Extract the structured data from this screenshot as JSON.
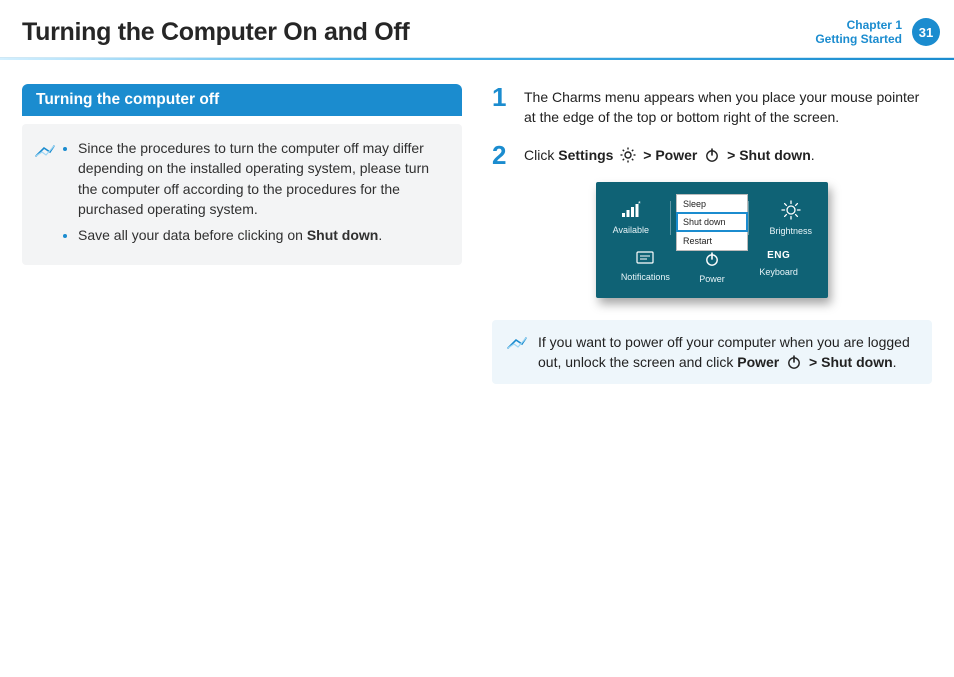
{
  "header": {
    "title": "Turning the Computer On and Off",
    "chapter_line1": "Chapter 1",
    "chapter_line2": "Getting Started",
    "page_number": "31"
  },
  "section": {
    "title": "Turning the computer off"
  },
  "note": {
    "bullets": [
      {
        "text_a": "Since the procedures to turn the computer off may differ depending on the installed operating system, please turn the computer off according to the procedures for the purchased operating system."
      },
      {
        "text_a": "Save all your data before clicking on ",
        "bold_b": "Shut down",
        "text_c": "."
      }
    ]
  },
  "steps": [
    {
      "num": "1",
      "text": "The Charms menu appears when you place your mouse pointer at the edge of the top or bottom right of the screen."
    },
    {
      "num": "2",
      "p1_a": "Click ",
      "p1_bold1": "Settings",
      "p1_sep1": " > ",
      "p1_bold2": "Power",
      "p1_sep2": " > ",
      "p1_bold3": "Shut down",
      "p1_end": "."
    }
  ],
  "charms": {
    "menu": {
      "sleep": "Sleep",
      "shutdown": "Shut down",
      "restart": "Restart"
    },
    "top_left": "Available",
    "top_right": "Brightness",
    "bottom": {
      "left": "Notifications",
      "mid": "Power",
      "right_label": "Keyboard",
      "right_badge": "ENG"
    }
  },
  "tip": {
    "a": "If you want to power off your computer when you are logged out, unlock the screen and click ",
    "bold1": "Power",
    "sep": " > ",
    "bold2": "Shut down",
    "end": "."
  }
}
